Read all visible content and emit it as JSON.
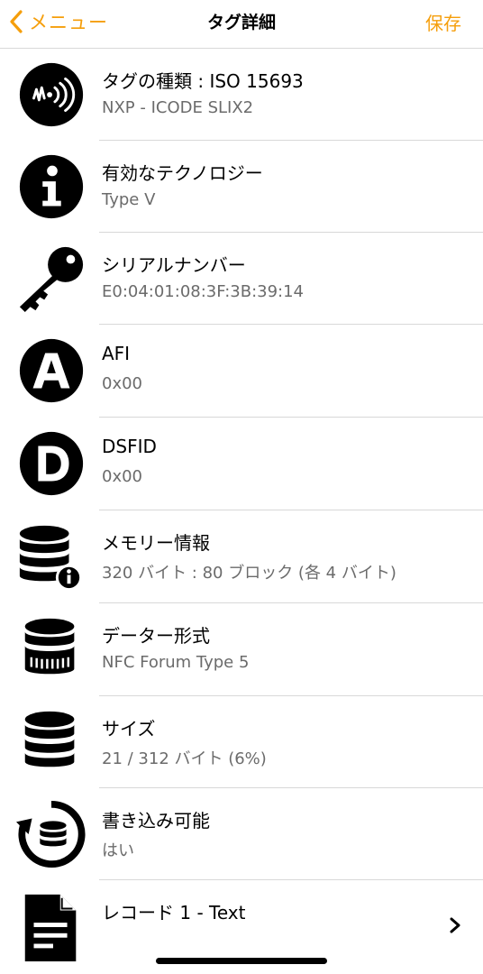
{
  "nav": {
    "back_label": "メニュー",
    "title": "タグ詳細",
    "save_label": "保存",
    "accent_color": "#F59E0B"
  },
  "rows": [
    {
      "icon": "nfc-icon",
      "title": "タグの種類 : ISO 15693",
      "value": "NXP - ICODE SLIX2"
    },
    {
      "icon": "info-icon",
      "title": "有効なテクノロジー",
      "value": "Type V"
    },
    {
      "icon": "key-icon",
      "title": "シリアルナンバー",
      "value": "E0:04:01:08:3F:3B:39:14"
    },
    {
      "icon": "letter-a-icon",
      "title": "AFI",
      "value": "0x00"
    },
    {
      "icon": "letter-d-icon",
      "title": "DSFID",
      "value": "0x00"
    },
    {
      "icon": "database-info-icon",
      "title": "メモリー情報",
      "value": "320 バイト : 80 ブロック (各 4 バイト)"
    },
    {
      "icon": "database-striped-icon",
      "title": "データー形式",
      "value": "NFC Forum Type 5"
    },
    {
      "icon": "database-icon",
      "title": "サイズ",
      "value": "21 / 312 バイト (6%)"
    },
    {
      "icon": "database-rotate-icon",
      "title": "書き込み可能",
      "value": "はい"
    },
    {
      "icon": "document-icon",
      "title": "レコード 1 - Text",
      "value": ""
    }
  ]
}
